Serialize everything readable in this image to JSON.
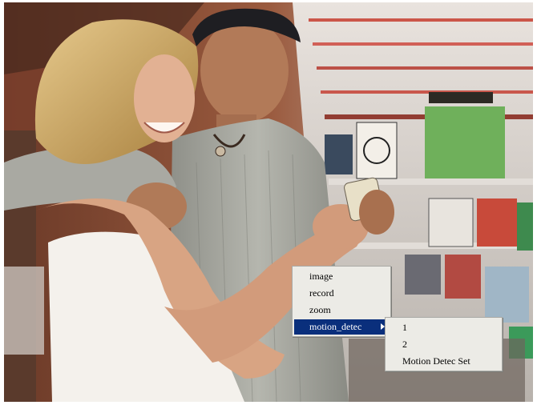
{
  "context_menu": {
    "items": [
      {
        "label": "image"
      },
      {
        "label": "record"
      },
      {
        "label": "zoom"
      },
      {
        "label": "motion_detec",
        "selected": true,
        "has_submenu": true
      }
    ]
  },
  "submenu": {
    "items": [
      {
        "label": "1"
      },
      {
        "label": "2"
      },
      {
        "label": "Motion Detec Set"
      }
    ]
  },
  "colors": {
    "menu_background": "#ecebe6",
    "selection": "#0a2f7c"
  },
  "icons": {
    "submenu_arrow": "triangle-right-icon"
  }
}
